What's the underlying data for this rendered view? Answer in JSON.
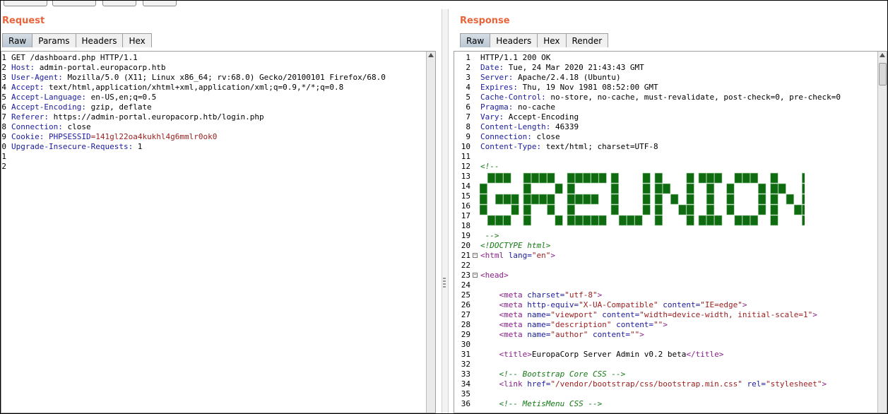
{
  "request": {
    "title": "Request",
    "tabs": [
      "Raw",
      "Params",
      "Headers",
      "Hex"
    ],
    "lines": [
      {
        "n": "1",
        "parts": [
          {
            "t": "GET /dashboard.php HTTP/1.1",
            "c": "hval"
          }
        ]
      },
      {
        "n": "2",
        "parts": [
          {
            "t": "Host:",
            "c": "hname"
          },
          {
            "t": " admin-portal.europacorp.htb",
            "c": "hval"
          }
        ]
      },
      {
        "n": "3",
        "parts": [
          {
            "t": "User-Agent:",
            "c": "hname"
          },
          {
            "t": " Mozilla/5.0 (X11; Linux x86_64; rv:68.0) Gecko/20100101 Firefox/68.0",
            "c": "hval"
          }
        ]
      },
      {
        "n": "4",
        "parts": [
          {
            "t": "Accept:",
            "c": "hname"
          },
          {
            "t": " text/html,application/xhtml+xml,application/xml;q=0.9,*/*;q=0.8",
            "c": "hval"
          }
        ]
      },
      {
        "n": "5",
        "parts": [
          {
            "t": "Accept-Language:",
            "c": "hname"
          },
          {
            "t": " en-US,en;q=0.5",
            "c": "hval"
          }
        ]
      },
      {
        "n": "6",
        "parts": [
          {
            "t": "Accept-Encoding:",
            "c": "hname"
          },
          {
            "t": " gzip, deflate",
            "c": "hval"
          }
        ]
      },
      {
        "n": "7",
        "parts": [
          {
            "t": "Referer:",
            "c": "hname"
          },
          {
            "t": " https://admin-portal.europacorp.htb/login.php",
            "c": "hval"
          }
        ]
      },
      {
        "n": "8",
        "parts": [
          {
            "t": "Connection:",
            "c": "hname"
          },
          {
            "t": " close",
            "c": "hval"
          }
        ]
      },
      {
        "n": "9",
        "parts": [
          {
            "t": "Cookie:",
            "c": "hname"
          },
          {
            "t": " PHPSESSID",
            "c": "hname"
          },
          {
            "t": "=141gl22oa4kukhl4g6mmlr0ok0",
            "c": "cookie"
          }
        ]
      },
      {
        "n": "0",
        "parts": [
          {
            "t": "Upgrade-Insecure-Requests:",
            "c": "hname"
          },
          {
            "t": " 1",
            "c": "hval"
          }
        ]
      },
      {
        "n": "1",
        "parts": []
      },
      {
        "n": "2",
        "parts": []
      }
    ]
  },
  "response": {
    "title": "Response",
    "tabs": [
      "Raw",
      "Headers",
      "Hex",
      "Render"
    ],
    "ascii_art": "GREUNION",
    "lines": [
      {
        "n": "1",
        "parts": [
          {
            "t": "HTTP/1.1 200 OK",
            "c": "hval"
          }
        ]
      },
      {
        "n": "2",
        "parts": [
          {
            "t": "Date:",
            "c": "hname"
          },
          {
            "t": " Tue, 24 Mar 2020 21:43:43 GMT",
            "c": "hval"
          }
        ]
      },
      {
        "n": "3",
        "parts": [
          {
            "t": "Server:",
            "c": "hname"
          },
          {
            "t": " Apache/2.4.18 (Ubuntu)",
            "c": "hval"
          }
        ]
      },
      {
        "n": "4",
        "parts": [
          {
            "t": "Expires:",
            "c": "hname"
          },
          {
            "t": " Thu, 19 Nov 1981 08:52:00 GMT",
            "c": "hval"
          }
        ]
      },
      {
        "n": "5",
        "parts": [
          {
            "t": "Cache-Control:",
            "c": "hname"
          },
          {
            "t": " no-store, no-cache, must-revalidate, post-check=0, pre-check=0",
            "c": "hval"
          }
        ]
      },
      {
        "n": "6",
        "parts": [
          {
            "t": "Pragma:",
            "c": "hname"
          },
          {
            "t": " no-cache",
            "c": "hval"
          }
        ]
      },
      {
        "n": "7",
        "parts": [
          {
            "t": "Vary:",
            "c": "hname"
          },
          {
            "t": " Accept-Encoding",
            "c": "hval"
          }
        ]
      },
      {
        "n": "8",
        "parts": [
          {
            "t": "Content-Length:",
            "c": "hname"
          },
          {
            "t": " 46339",
            "c": "hval"
          }
        ]
      },
      {
        "n": "9",
        "parts": [
          {
            "t": "Connection:",
            "c": "hname"
          },
          {
            "t": " close",
            "c": "hval"
          }
        ]
      },
      {
        "n": "10",
        "parts": [
          {
            "t": "Content-Type:",
            "c": "hname"
          },
          {
            "t": " text/html; charset=UTF-8",
            "c": "hval"
          }
        ]
      },
      {
        "n": "11",
        "parts": []
      },
      {
        "n": "12",
        "parts": [
          {
            "t": "<!--",
            "c": "cmt"
          }
        ]
      },
      {
        "n": "13",
        "parts": []
      },
      {
        "n": "14",
        "parts": []
      },
      {
        "n": "15",
        "parts": []
      },
      {
        "n": "16",
        "parts": []
      },
      {
        "n": "17",
        "parts": []
      },
      {
        "n": "18",
        "parts": []
      },
      {
        "n": "19",
        "parts": [
          {
            "t": " -->",
            "c": "cmt"
          }
        ]
      },
      {
        "n": "20",
        "parts": [
          {
            "t": "<!DOCTYPE html>",
            "c": "cmt"
          }
        ]
      },
      {
        "n": "21",
        "fold": true,
        "parts": [
          {
            "t": "<html ",
            "c": "tag"
          },
          {
            "t": "lang=",
            "c": "attr"
          },
          {
            "t": "\"en\"",
            "c": "str"
          },
          {
            "t": ">",
            "c": "tag"
          }
        ]
      },
      {
        "n": "22",
        "parts": []
      },
      {
        "n": "23",
        "fold": true,
        "parts": [
          {
            "t": "<head>",
            "c": "tag"
          }
        ]
      },
      {
        "n": "24",
        "parts": []
      },
      {
        "n": "25",
        "parts": [
          {
            "t": "    <meta ",
            "c": "tag"
          },
          {
            "t": "charset=",
            "c": "attr"
          },
          {
            "t": "\"utf-8\"",
            "c": "str"
          },
          {
            "t": ">",
            "c": "tag"
          }
        ]
      },
      {
        "n": "26",
        "parts": [
          {
            "t": "    <meta ",
            "c": "tag"
          },
          {
            "t": "http-equiv=",
            "c": "attr"
          },
          {
            "t": "\"X-UA-Compatible\"",
            "c": "str"
          },
          {
            "t": " content=",
            "c": "attr"
          },
          {
            "t": "\"IE=edge\"",
            "c": "str"
          },
          {
            "t": ">",
            "c": "tag"
          }
        ]
      },
      {
        "n": "27",
        "parts": [
          {
            "t": "    <meta ",
            "c": "tag"
          },
          {
            "t": "name=",
            "c": "attr"
          },
          {
            "t": "\"viewport\"",
            "c": "str"
          },
          {
            "t": " content=",
            "c": "attr"
          },
          {
            "t": "\"width=device-width, initial-scale=1\"",
            "c": "str"
          },
          {
            "t": ">",
            "c": "tag"
          }
        ]
      },
      {
        "n": "28",
        "parts": [
          {
            "t": "    <meta ",
            "c": "tag"
          },
          {
            "t": "name=",
            "c": "attr"
          },
          {
            "t": "\"description\"",
            "c": "str"
          },
          {
            "t": " content=",
            "c": "attr"
          },
          {
            "t": "\"\"",
            "c": "str"
          },
          {
            "t": ">",
            "c": "tag"
          }
        ]
      },
      {
        "n": "29",
        "parts": [
          {
            "t": "    <meta ",
            "c": "tag"
          },
          {
            "t": "name=",
            "c": "attr"
          },
          {
            "t": "\"author\"",
            "c": "str"
          },
          {
            "t": " content=",
            "c": "attr"
          },
          {
            "t": "\"\"",
            "c": "str"
          },
          {
            "t": ">",
            "c": "tag"
          }
        ]
      },
      {
        "n": "30",
        "parts": []
      },
      {
        "n": "31",
        "parts": [
          {
            "t": "    <title>",
            "c": "tag"
          },
          {
            "t": "EuropaCorp Server Admin v0.2 beta",
            "c": "hval"
          },
          {
            "t": "</title>",
            "c": "tag"
          }
        ]
      },
      {
        "n": "32",
        "parts": []
      },
      {
        "n": "33",
        "parts": [
          {
            "t": "    <!-- Bootstrap Core CSS -->",
            "c": "cmt"
          }
        ]
      },
      {
        "n": "34",
        "parts": [
          {
            "t": "    <link ",
            "c": "tag"
          },
          {
            "t": "href=",
            "c": "attr"
          },
          {
            "t": "\"/vendor/bootstrap/css/bootstrap.min.css\"",
            "c": "str"
          },
          {
            "t": " rel=",
            "c": "attr"
          },
          {
            "t": "\"stylesheet\"",
            "c": "str"
          },
          {
            "t": ">",
            "c": "tag"
          }
        ]
      },
      {
        "n": "35",
        "parts": []
      },
      {
        "n": "36",
        "parts": [
          {
            "t": "    <!-- MetisMenu CSS -->",
            "c": "cmt"
          }
        ]
      }
    ]
  },
  "colors": {
    "accent": "#e8643a",
    "tab_active": "#c6d1dc",
    "ascii_green": "#0f6b0f"
  }
}
